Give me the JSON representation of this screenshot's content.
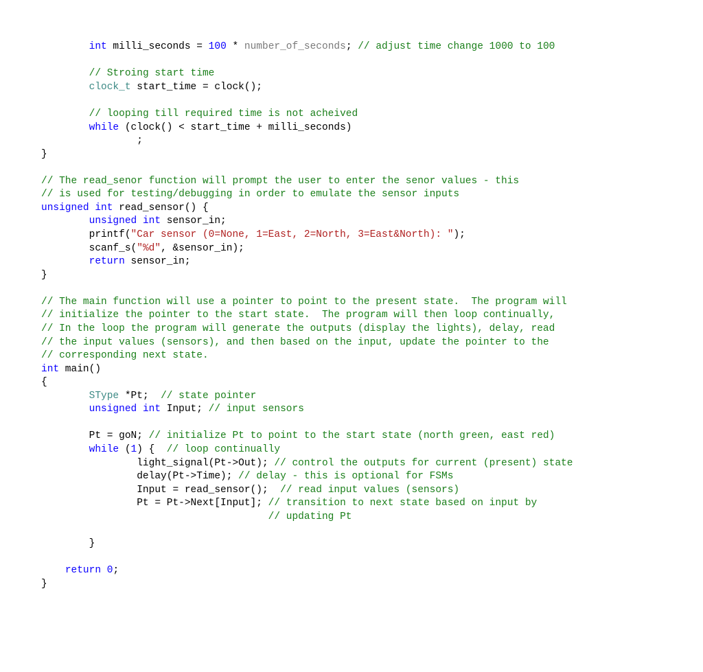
{
  "code": {
    "l1_indent": "        ",
    "l1_kw": "int",
    "l1_id": " milli_seconds = ",
    "l1_num": "100",
    "l1_op": " * ",
    "l1_gray": "number_of_seconds",
    "l1_semi": "; ",
    "l1_cmt": "// adjust time change 1000 to 100",
    "l2_indent": "        ",
    "l2_cmt": "// Stroing start time",
    "l3_indent": "        ",
    "l3_typ": "clock_t",
    "l3_rest": " start_time = clock();",
    "l4_indent": "        ",
    "l4_cmt": "// looping till required time is not acheived",
    "l5_indent": "        ",
    "l5_kw": "while",
    "l5_rest": " (clock() < start_time + milli_seconds)",
    "l6_indent": "                ",
    "l6_rest": ";",
    "l7_rest": "}",
    "l8_cmt": "// The read_senor function will prompt the user to enter the senor values - this",
    "l9_cmt": "// is used for testing/debugging in order to emulate the sensor inputs",
    "l10_kw": "unsigned int",
    "l10_rest": " read_sensor() {",
    "l11_indent": "        ",
    "l11_kw": "unsigned int",
    "l11_rest": " sensor_in;",
    "l12_indent": "        ",
    "l12_fn": "printf(",
    "l12_str": "\"Car sensor (0=None, 1=East, 2=North, 3=East&North): \"",
    "l12_end": ");",
    "l13_indent": "        ",
    "l13_fn": "scanf_s(",
    "l13_str": "\"%d\"",
    "l13_end": ", &sensor_in);",
    "l14_indent": "        ",
    "l14_kw": "return",
    "l14_rest": " sensor_in;",
    "l15_rest": "}",
    "l16_cmt": "// The main function will use a pointer to point to the present state.  The program will",
    "l17_cmt": "// initialize the pointer to the start state.  The program will then loop continually,",
    "l18_cmt": "// In the loop the program will generate the outputs (display the lights), delay, read",
    "l19_cmt": "// the input values (sensors), and then based on the input, update the pointer to the",
    "l20_cmt": "// corresponding next state.",
    "l21_kw": "int",
    "l21_rest": " main()",
    "l22_rest": "{",
    "l23_indent": "        ",
    "l23_typ": "SType",
    "l23_rest": " *Pt;  ",
    "l23_cmt": "// state pointer",
    "l24_indent": "        ",
    "l24_kw": "unsigned int",
    "l24_rest": " Input; ",
    "l24_cmt": "// input sensors",
    "l25_indent": "        ",
    "l25_rest": "Pt = goN; ",
    "l25_cmt": "// initialize Pt to point to the start state (north green, east red)",
    "l26_indent": "        ",
    "l26_kw": "while",
    "l26_rest1": " (",
    "l26_num": "1",
    "l26_rest2": ") {  ",
    "l26_cmt": "// loop continually",
    "l27_indent": "                ",
    "l27_rest": "light_signal(Pt->Out); ",
    "l27_cmt": "// control the outputs for current (present) state",
    "l28_indent": "                ",
    "l28_rest": "delay(Pt->Time); ",
    "l28_cmt": "// delay - this is optional for FSMs",
    "l29_indent": "                ",
    "l29_rest": "Input = read_sensor();  ",
    "l29_cmt": "// read input values (sensors)",
    "l30_indent": "                ",
    "l30_rest": "Pt = Pt->Next[Input]; ",
    "l30_cmt": "// transition to next state based on input by",
    "l31_indent": "                                      ",
    "l31_cmt": "// updating Pt",
    "l32_indent": "        ",
    "l32_rest": "}",
    "l33_indent": "    ",
    "l33_kw": "return",
    "l33_sp": " ",
    "l33_num": "0",
    "l33_end": ";",
    "l34_rest": "}"
  }
}
